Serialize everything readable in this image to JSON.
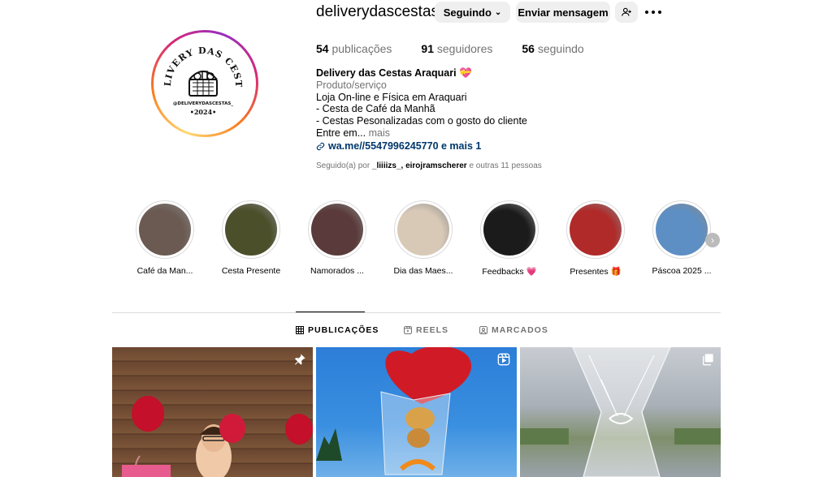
{
  "header": {
    "username": "deliverydascestas_",
    "follow_button": "Seguindo",
    "message_button": "Enviar mensagem",
    "add_person_icon": "person-plus-icon",
    "more_icon": "ellipsis-icon"
  },
  "avatar": {
    "logo_title": "DELIVERY DAS CESTAS",
    "logo_handle": "@DELIVERYDASCESTAS_",
    "logo_year": "•2024•"
  },
  "stats": {
    "posts_count": "54",
    "posts_label": "publicações",
    "followers_count": "91",
    "followers_label": "seguidores",
    "following_count": "56",
    "following_label": "seguindo"
  },
  "bio": {
    "name": "Delivery das Cestas Araquari",
    "name_emoji": "💝",
    "category": "Produto/serviço",
    "lines": [
      "Loja On-line e Física em Araquari",
      "- Cesta de Café da Manhã",
      "- Cestas Pesonalizadas com o gosto do cliente"
    ],
    "truncated": "Entre em...",
    "more_label": "mais",
    "link": "wa.me//5547996245770 e mais 1"
  },
  "followed_by": {
    "prefix": "Seguido(a) por",
    "users": "_liiiizs_, eirojramscherer",
    "suffix": "e outras 11 pessoas"
  },
  "highlights": [
    {
      "label": "Café da Man...",
      "color": "#6b5a52"
    },
    {
      "label": "Cesta Presente",
      "color": "#4b4f2a"
    },
    {
      "label": "Namorados ...",
      "color": "#5a3a3a"
    },
    {
      "label": "Dia das Maes...",
      "color": "#d8c9b7"
    },
    {
      "label": "Feedbacks 💗",
      "color": "#1b1b1b"
    },
    {
      "label": "Presentes 🎁",
      "color": "#b02a2a"
    },
    {
      "label": "Páscoa 2025 ...",
      "color": "#5d8fc4"
    }
  ],
  "tabs": [
    {
      "label": "PUBLICAÇÕES",
      "icon": "grid-icon",
      "active": true
    },
    {
      "label": "REELS",
      "icon": "reels-icon",
      "active": false
    },
    {
      "label": "MARCADOS",
      "icon": "tagged-icon",
      "active": false
    }
  ],
  "posts": [
    {
      "icon": "pin-icon"
    },
    {
      "icon": "reel-icon"
    },
    {
      "icon": "carousel-icon"
    }
  ]
}
